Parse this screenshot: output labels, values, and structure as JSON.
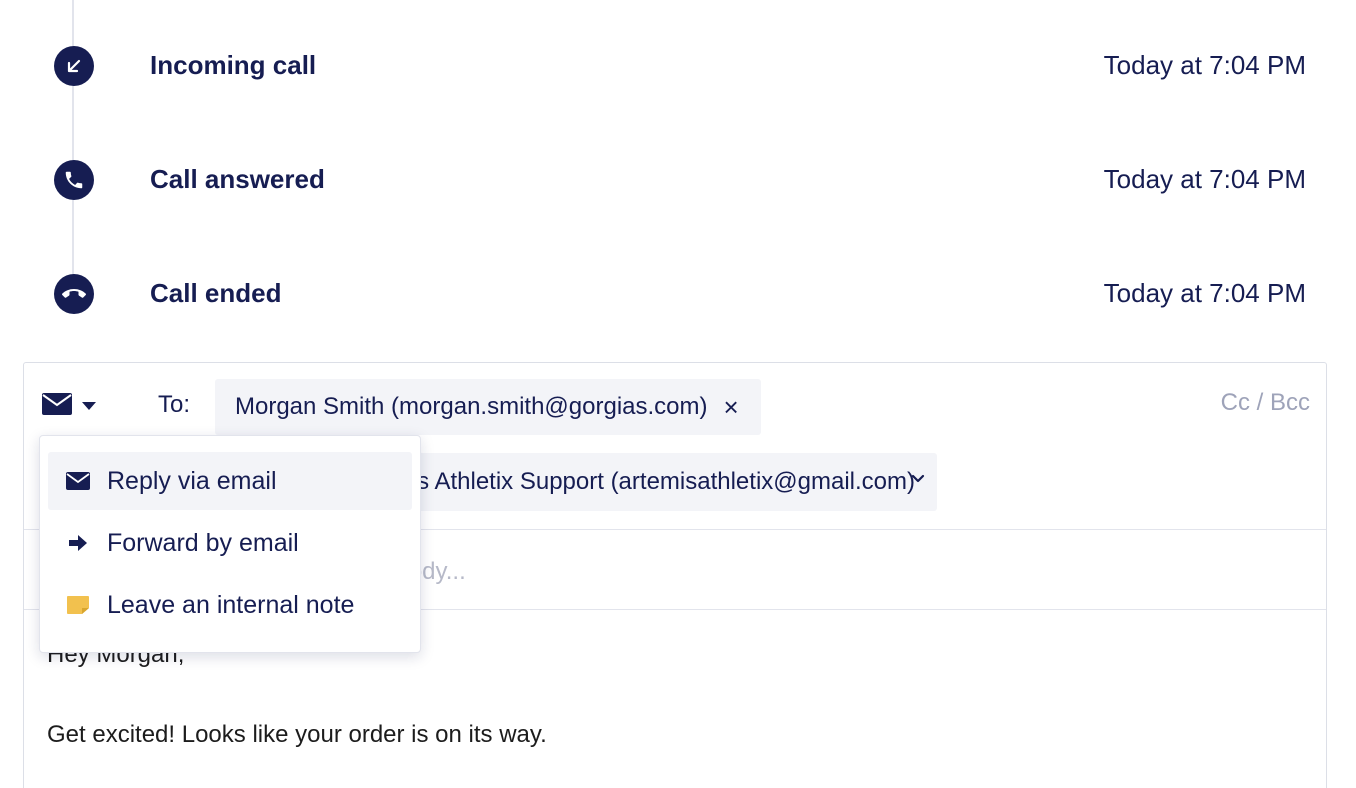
{
  "timeline": {
    "events": [
      {
        "title": "Incoming call",
        "time": "Today at 7:04 PM",
        "icon": "arrow-down-left-icon"
      },
      {
        "title": "Call answered",
        "time": "Today at 7:04 PM",
        "icon": "phone-icon"
      },
      {
        "title": "Call ended",
        "time": "Today at 7:04 PM",
        "icon": "phone-hangup-icon"
      }
    ]
  },
  "composer": {
    "to_label": "To:",
    "recipient": "Morgan Smith (morgan.smith@gorgias.com)",
    "remove_symbol": "×",
    "cc_bcc": "Cc / Bcc",
    "from": "Artemis Athletix Support (artemisathletix@gmail.com)",
    "subject_placeholder": "Search macros by name, tags or body...",
    "body": {
      "greeting": "Hey Morgan,",
      "line1": "Get excited! Looks like your order is on its way."
    }
  },
  "channel_menu": {
    "items": [
      {
        "label": "Reply via email",
        "icon": "email-icon",
        "active": true
      },
      {
        "label": "Forward by email",
        "icon": "arrow-right-icon",
        "active": false
      },
      {
        "label": "Leave an internal note",
        "icon": "note-icon",
        "active": false
      }
    ]
  },
  "colors": {
    "navy": "#161d52",
    "chip_bg": "#f3f4f8",
    "muted": "#9ea3b9",
    "note_yellow": "#f2c14e"
  }
}
